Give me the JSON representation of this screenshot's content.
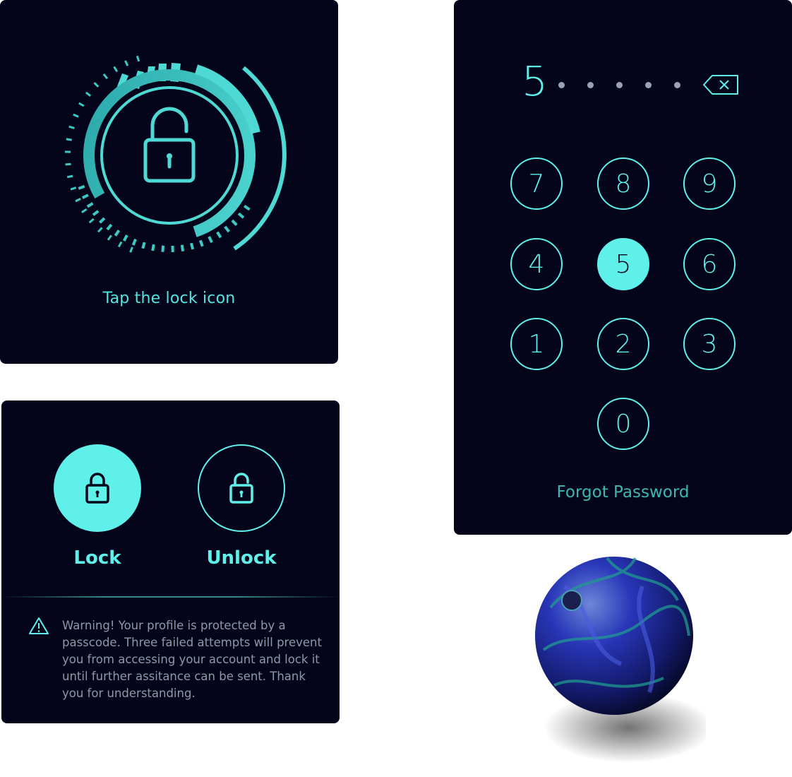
{
  "lock_card": {
    "instruction": "Tap the lock icon"
  },
  "toggle_card": {
    "lock_label": "Lock",
    "unlock_label": "Unlock",
    "warning": "Warning! Your profile is protected by a passcode. Three failed attempts will prevent you from accessing your account and lock it until further assitance can be sent. Thank you for understanding."
  },
  "pin_card": {
    "entered_digit": "5",
    "remaining_placeholders": 5,
    "keys": [
      "7",
      "8",
      "9",
      "4",
      "5",
      "6",
      "1",
      "2",
      "3",
      "0"
    ],
    "active_key": "5",
    "forgot_password": "Forgot Password"
  },
  "colors": {
    "accent": "#5ff0ea",
    "card_bg": "#04051a",
    "muted_text": "#9098a8",
    "dim_accent": "#3fb6b2"
  },
  "icons": [
    "lock-icon",
    "unlock-icon",
    "warning-icon",
    "backspace-icon"
  ]
}
